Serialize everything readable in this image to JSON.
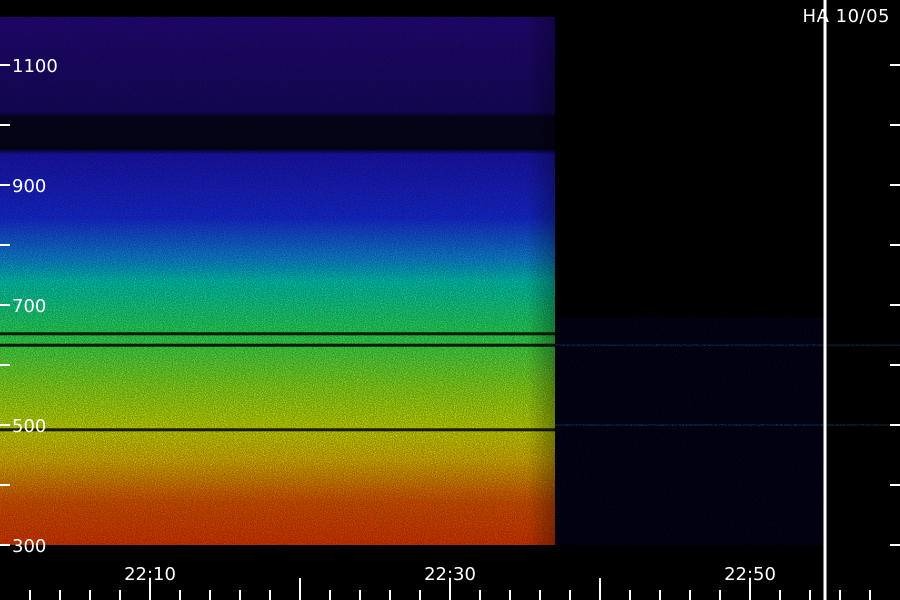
{
  "chart_data": {
    "type": "heatmap",
    "title": "HA 10/05",
    "xlabel": "",
    "ylabel": "",
    "x_unit": "minutes since 22:00 UT",
    "x_range": [
      0,
      60
    ],
    "ylim": [
      300,
      1200
    ],
    "x_tick_labels": [
      "22:10",
      "22:30",
      "22:50"
    ],
    "x_tick_values": [
      10,
      30,
      50
    ],
    "y_tick_labels": [
      "300",
      "500",
      "700",
      "900",
      "1100"
    ],
    "y_tick_values": [
      300,
      500,
      700,
      900,
      1100
    ],
    "y_minor_ticks": [
      400,
      600,
      800,
      1000
    ],
    "marker_line_time": "22:55",
    "colormap": [
      "#000010",
      "#1a0a80",
      "#1414ff",
      "#00d0ff",
      "#00ff90",
      "#c8ff00",
      "#ffff00",
      "#ff8000",
      "#ff2000"
    ],
    "colors": {
      "background": "#000000",
      "text": "#ffffff",
      "marker": "#ffffff"
    }
  }
}
